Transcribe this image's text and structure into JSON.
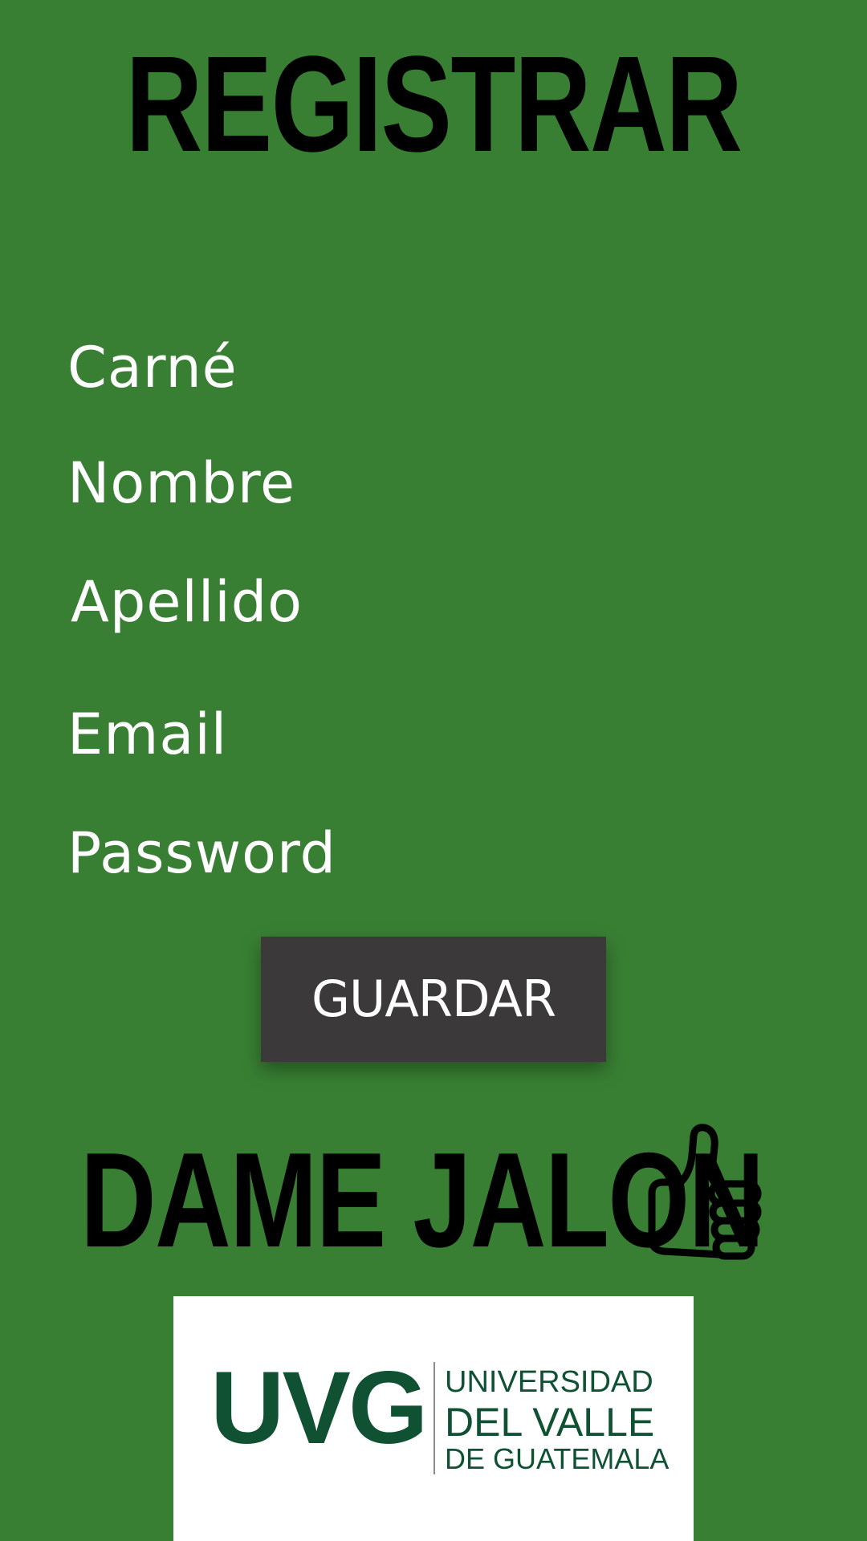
{
  "header": {
    "title": "REGISTRAR"
  },
  "form": {
    "fields": [
      {
        "label": "Carné",
        "value": ""
      },
      {
        "label": "Nombre",
        "value": ""
      },
      {
        "label": "Apellido",
        "value": ""
      },
      {
        "label": "Email",
        "value": ""
      },
      {
        "label": "Password",
        "value": ""
      }
    ],
    "submit_label": "GUARDAR"
  },
  "footer": {
    "slogan": "DAME JALON",
    "slogan_icon": "thumbs-up-icon",
    "logo": {
      "abbr": "UVG",
      "line1": "UNIVERSIDAD",
      "line2": "DEL VALLE",
      "line3": "DE GUATEMALA"
    }
  },
  "colors": {
    "background": "#387f33",
    "button": "#3b393a",
    "logo_green": "#0f5132",
    "text_light": "#ffffff",
    "text_dark": "#000000"
  }
}
